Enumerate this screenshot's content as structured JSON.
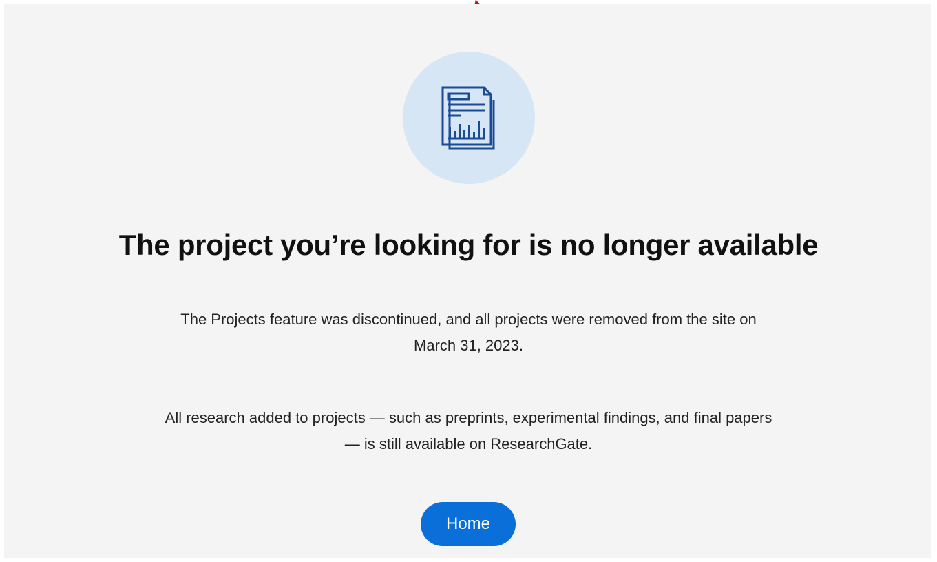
{
  "icon": {
    "name": "report-document-icon",
    "circle_color": "#d6e6f4",
    "stroke_color": "#1b4a97"
  },
  "heading": "The project you’re looking for is no longer available",
  "paragraphs": {
    "discontinued": {
      "line1": "The Projects feature was discontinued, and all projects were removed from the site on",
      "line2": "March 31, 2023."
    },
    "research": {
      "line1": "All research added to projects — such as preprints, experimental findings, and final papers",
      "line2": "— is still available on ResearchGate."
    }
  },
  "home_button": {
    "label": "Home",
    "color": "#0a6fd8"
  },
  "pointer_color": "#e00000"
}
